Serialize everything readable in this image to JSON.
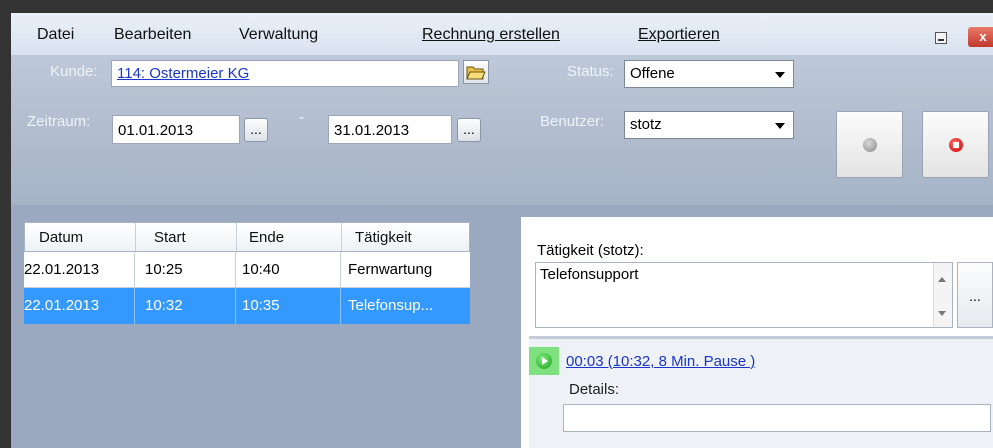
{
  "menu": {
    "datei": "Datei",
    "bearbeiten": "Bearbeiten",
    "verwaltung": "Verwaltung",
    "rechnung": "Rechnung erstellen",
    "exportieren": "Exportieren",
    "close_glyph": "x"
  },
  "header": {
    "kunde_label": "Kunde:",
    "kunde_value": "114: Ostermeier KG",
    "zeitraum_label": "Zeitraum:",
    "date_from": "01.01.2013",
    "date_sep": "-",
    "date_to": "31.01.2013",
    "dots": "...",
    "status_label": "Status:",
    "status_value": "Offene",
    "benutzer_label": "Benutzer:",
    "benutzer_value": "stotz"
  },
  "table": {
    "columns": [
      "Datum",
      "Start",
      "Ende",
      "Tätigkeit"
    ],
    "rows": [
      {
        "datum": "22.01.2013",
        "start": "10:25",
        "ende": "10:40",
        "taetigkeit": "Fernwartung"
      },
      {
        "datum": "22.01.2013",
        "start": "10:32",
        "ende": "10:35",
        "taetigkeit": "Telefonsup..."
      }
    ]
  },
  "detail": {
    "title": "Tätigkeit (stotz):",
    "text": "Telefonsupport",
    "dots": "...",
    "time_link": "00:03 (10:32, 8 Min. Pause )",
    "details_label": "Details:",
    "details_value": ""
  },
  "colors": {
    "selection": "#3399ff",
    "link": "#1a35c8",
    "stop_red": "#e00000"
  }
}
